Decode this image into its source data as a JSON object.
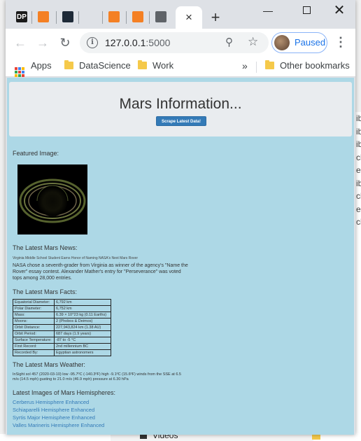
{
  "browser": {
    "active_tab_close": "×",
    "new_tab": "+",
    "url_host": "127.0.0.1",
    "url_port": ":5000",
    "profile_status": "Paused",
    "tab_favicons": [
      {
        "name": "dp-favicon",
        "text": "DP",
        "bg": "#1b1b1b",
        "fg": "#ffffff"
      },
      {
        "name": "stackoverflow-favicon",
        "text": "",
        "bg": "#f48024",
        "fg": "#ffffff"
      },
      {
        "name": "terminal-favicon",
        "text": "",
        "bg": "#1e2a38",
        "fg": "#ffffff"
      },
      {
        "name": "moon-favicon",
        "text": "",
        "bg": "#dee1e6",
        "fg": "#333333"
      },
      {
        "name": "stackoverflow-favicon",
        "text": "",
        "bg": "#f48024",
        "fg": "#ffffff"
      },
      {
        "name": "stackoverflow-favicon",
        "text": "",
        "bg": "#f48024",
        "fg": "#ffffff"
      },
      {
        "name": "globe-favicon",
        "text": "",
        "bg": "#5f6368",
        "fg": "#ffffff"
      }
    ]
  },
  "bookmarks": {
    "apps": "Apps",
    "items": [
      "DataScience",
      "Work"
    ],
    "more": "»",
    "other": "Other bookmarks"
  },
  "page": {
    "title": "Mars Information...",
    "scrape_button": "Scrape Latest Data!",
    "featured_label": "Featured Image:",
    "news_heading": "The Latest Mars News:",
    "news_title": "Virginia Middle School Student Earns Honor of Naming NASA's Next Mars Rover",
    "news_paragraph": "NASA chose a seventh-grader from Virginia as winner of the agency's \"Name the Rover\" essay contest. Alexander Mather's entry for \"Perseverance\" was voted tops among 28,000 entries.",
    "facts_heading": "The Latest Mars Facts:",
    "facts": [
      [
        "Equatorial Diameter:",
        "6,792 km"
      ],
      [
        "Polar Diameter:",
        "6,752 km"
      ],
      [
        "Mass:",
        "6.39 × 10^23 kg (0.11 Earths)"
      ],
      [
        "Moons:",
        "2 (Phobos & Deimos)"
      ],
      [
        "Orbit Distance:",
        "227,943,824 km (1.38 AU)"
      ],
      [
        "Orbit Period:",
        "687 days (1.9 years)"
      ],
      [
        "Surface Temperature:",
        "-87 to -5 °C"
      ],
      [
        "First Record:",
        "2nd millennium BC"
      ],
      [
        "Recorded By:",
        "Egyptian astronomers"
      ]
    ],
    "weather_heading": "The Latest Mars Weather:",
    "weather_text": "InSight sol 457 (2020-03-10) low -95.7ºC (-140.3ºF) high -9.1ºC (15.6ºF) winds from the SSE at 6.5 m/s (14.5 mph) gusting to 21.0 m/s (46.9 mph) pressure at 6.30 hPa",
    "hemis_heading": "Latest Images of Mars Hemispheres:",
    "hemispheres": [
      "Cerberus Hemisphere Enhanced",
      "Schiaparelli Hemisphere Enhanced",
      "Syrtis Major Hemisphere Enhanced",
      "Valles Marineris Hemisphere Enhanced"
    ]
  },
  "background_window": {
    "side_letters": [
      "ib",
      "ib",
      "ib",
      "ch",
      "ep",
      "ib",
      "ch",
      "ep",
      "ch"
    ],
    "bottom_item": "Videos"
  },
  "colors": {
    "page_bg": "#add8e6",
    "jumbotron": "#e9ecef",
    "button_primary": "#337ab7",
    "link": "#337ab7"
  }
}
